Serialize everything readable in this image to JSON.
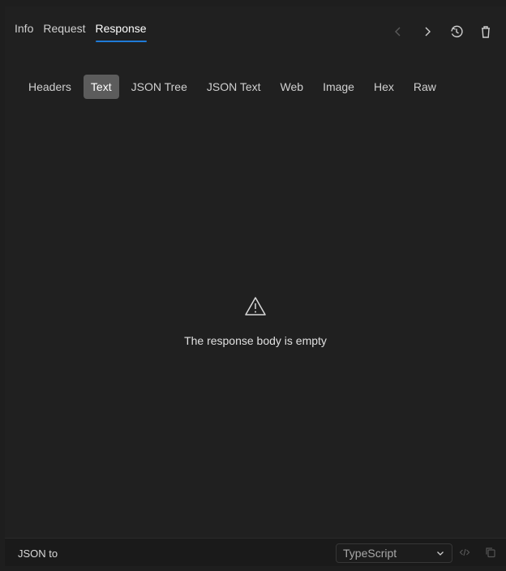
{
  "top_tabs": [
    {
      "label": "Info"
    },
    {
      "label": "Request"
    },
    {
      "label": "Response"
    }
  ],
  "top_actions": {
    "back_icon": "chevron-left-icon",
    "forward_icon": "chevron-right-icon",
    "history_icon": "history-icon",
    "delete_icon": "trash-icon"
  },
  "sub_tabs": [
    {
      "label": "Headers"
    },
    {
      "label": "Text"
    },
    {
      "label": "JSON Tree"
    },
    {
      "label": "JSON Text"
    },
    {
      "label": "Web"
    },
    {
      "label": "Image"
    },
    {
      "label": "Hex"
    },
    {
      "label": "Raw"
    }
  ],
  "empty_state": {
    "icon": "warning-icon",
    "message": "The response body is empty"
  },
  "bottom_bar": {
    "label": "JSON to",
    "language": "TypeScript",
    "code_icon": "code-icon",
    "copy_icon": "copy-icon"
  },
  "colors": {
    "background": "#202020",
    "accent": "#1f7bd8",
    "active_subtab": "#5c5c5c"
  }
}
